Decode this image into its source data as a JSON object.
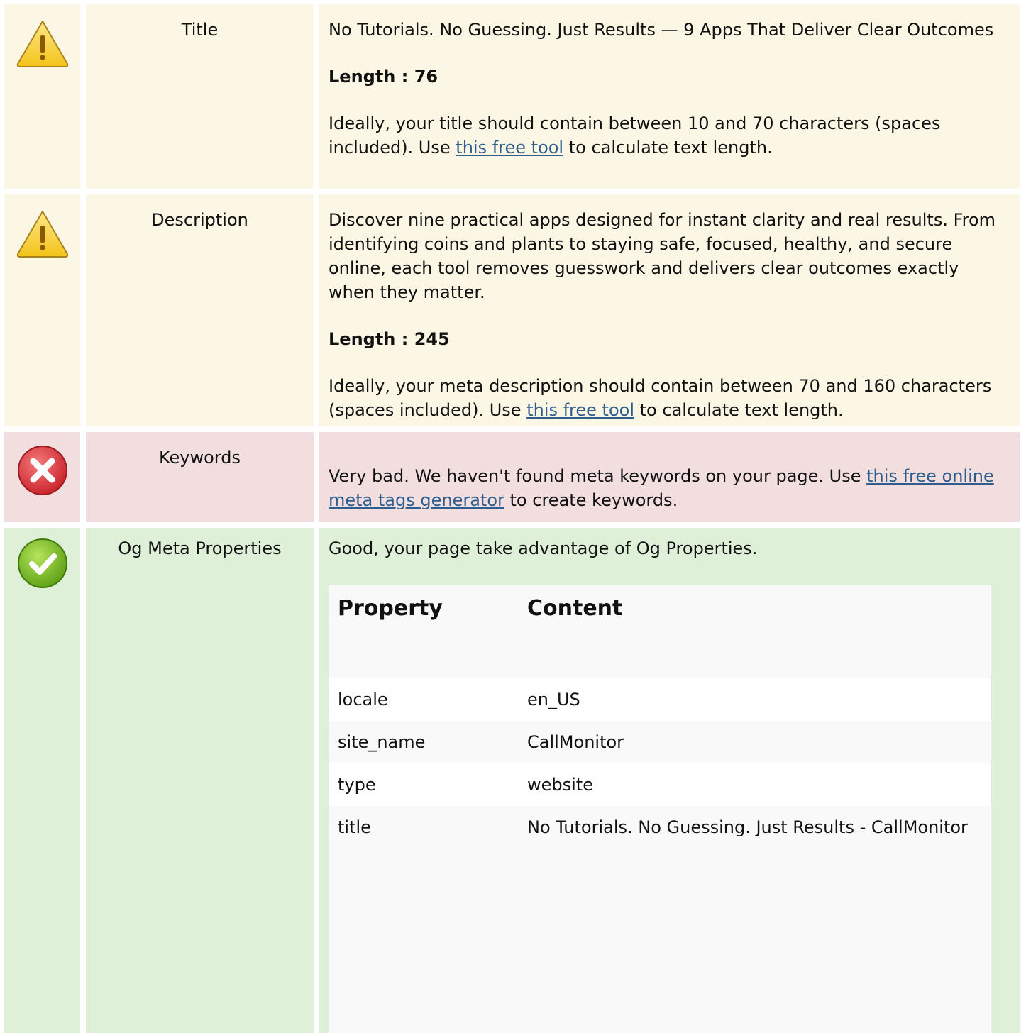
{
  "rows": {
    "title": {
      "status": "warning",
      "label": "Title",
      "text": "No Tutorials. No Guessing. Just Results — 9 Apps That Deliver Clear Outcomes",
      "length": "Length : 76",
      "advice_before": "Ideally, your title should contain between 10 and 70 characters (spaces included). Use ",
      "link": "this free tool",
      "advice_after": " to calculate text length."
    },
    "description": {
      "status": "warning",
      "label": "Description",
      "text": "Discover nine practical apps designed for instant clarity and real results. From identifying coins and plants to staying safe, focused, healthy, and secure online, each tool removes guesswork and delivers clear outcomes exactly when they matter.",
      "length": "Length : 245",
      "advice_before": "Ideally, your meta description should contain between 70 and 160 characters (spaces included). Use ",
      "link": "this free tool",
      "advice_after": " to calculate text length."
    },
    "keywords": {
      "status": "error",
      "label": "Keywords",
      "advice_before": "Very bad. We haven't found meta keywords on your page. Use ",
      "link": "this free online meta tags generator",
      "advice_after": " to create keywords."
    },
    "og": {
      "status": "success",
      "label": "Og Meta Properties",
      "text": "Good, your page take advantage of Og Properties.",
      "table": {
        "headers": [
          "Property",
          "Content"
        ],
        "rows": [
          {
            "property": "locale",
            "content": "en_US"
          },
          {
            "property": "site_name",
            "content": "CallMonitor"
          },
          {
            "property": "type",
            "content": "website"
          },
          {
            "property": "title",
            "content": "No Tutorials. No Guessing. Just Results - CallMonitor"
          }
        ]
      }
    }
  },
  "icons": {
    "warning": "warning-icon",
    "error": "error-icon",
    "success": "success-icon"
  },
  "colors": {
    "warning_bg": "#fcf7e4",
    "error_bg": "#f2dede",
    "success_bg": "#dff0d8",
    "link": "#2e5d8e"
  }
}
